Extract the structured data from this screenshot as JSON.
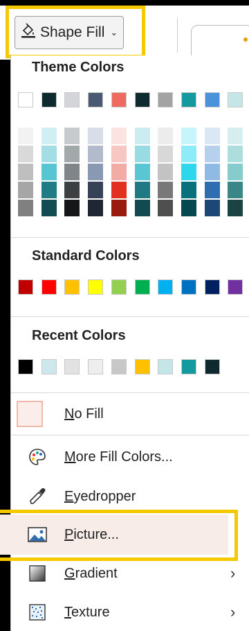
{
  "ribbon": {
    "shape_fill_label": "Shape Fill",
    "shape_fill_icon": "paint-bucket-icon",
    "chevron": "⌄"
  },
  "sections": {
    "theme": "Theme Colors",
    "standard": "Standard Colors",
    "recent": "Recent Colors"
  },
  "theme_colors": [
    "#ffffff",
    "#0e2a2e",
    "#d3d5d9",
    "#4a5a73",
    "#ef6a5f",
    "#0f2b2f",
    "#a3a3a3",
    "#14999f",
    "#4a92d9",
    "#c5e6e7"
  ],
  "theme_shades": [
    [
      "#f2f2f2",
      "#d9d9d9",
      "#bfbfbf",
      "#a6a6a6",
      "#808080"
    ],
    [
      "#d1eef2",
      "#a4dde5",
      "#58c5d2",
      "#1f7b84",
      "#134c52"
    ],
    [
      "#c8cbce",
      "#a3a8ab",
      "#7f8589",
      "#3c4043",
      "#161718"
    ],
    [
      "#d8dde7",
      "#b1bbcc",
      "#8a99b3",
      "#354257",
      "#1f2735"
    ],
    [
      "#fbe3e1",
      "#f7c7c3",
      "#f3aba5",
      "#e12f20",
      "#9a1a10"
    ],
    [
      "#cbedf1",
      "#98dbe3",
      "#58c6d3",
      "#207a84",
      "#134a51"
    ],
    [
      "#ececec",
      "#d8d8d8",
      "#c3c3c3",
      "#787878",
      "#4f4f4f"
    ],
    [
      "#c6f6fb",
      "#8decf7",
      "#2fd7ec",
      "#0a707b",
      "#054850"
    ],
    [
      "#dae8f6",
      "#b5d1ed",
      "#8fbae4",
      "#2e6db0",
      "#1d4775"
    ],
    [
      "#d7eeee",
      "#aedddd",
      "#86cccc",
      "#3a8686",
      "#1c4242"
    ]
  ],
  "standard_colors": [
    "#c00000",
    "#ff0000",
    "#ffc000",
    "#ffff00",
    "#92d050",
    "#00b050",
    "#00b0f0",
    "#0070c0",
    "#002060",
    "#7030a0"
  ],
  "recent_colors": [
    "#000000",
    "#cde8ec",
    "#e2e2e2",
    "#eeeeee",
    "#c8c8c8",
    "#ffc000",
    "#c5e6e7",
    "#14999f",
    "#0e2a2e"
  ],
  "menu": {
    "no_fill": {
      "pre": "",
      "ul": "N",
      "post": "o Fill"
    },
    "more_fill_colors": {
      "pre": "",
      "ul": "M",
      "post": "ore Fill Colors..."
    },
    "eyedropper": {
      "pre": "",
      "ul": "E",
      "post": "yedropper"
    },
    "picture": {
      "pre": "",
      "ul": "P",
      "post": "icture..."
    },
    "gradient": {
      "pre": "",
      "ul": "G",
      "post": "radient",
      "arrow": "›"
    },
    "texture": {
      "pre": "",
      "ul": "T",
      "post": "exture",
      "arrow": "›"
    }
  },
  "icons": {
    "palette": "palette-icon",
    "eyedropper": "eyedropper-icon",
    "picture": "picture-icon",
    "gradient": "gradient-icon",
    "texture": "texture-icon"
  },
  "accent_highlight": "#f5c800"
}
